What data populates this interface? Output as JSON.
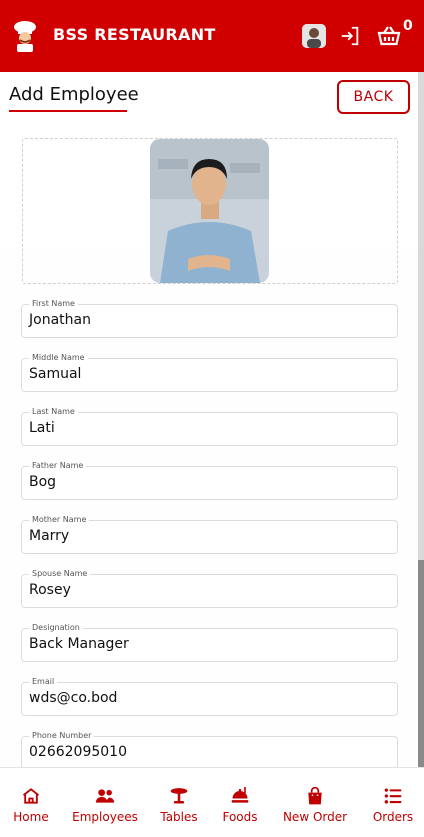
{
  "app": {
    "title": "BSS RESTAURANT",
    "cart_count": "0"
  },
  "header": {
    "icons": [
      "chef-logo-icon",
      "profile-avatar",
      "logout-icon",
      "basket-icon"
    ]
  },
  "page": {
    "title": "Add Employee",
    "back_label": "BACK"
  },
  "form": {
    "photo": "employee-photo",
    "fields": [
      {
        "label": "First Name",
        "value": "Jonathan"
      },
      {
        "label": "Middle Name",
        "value": "Samual"
      },
      {
        "label": "Last Name",
        "value": "Lati"
      },
      {
        "label": "Father Name",
        "value": "Bog"
      },
      {
        "label": "Mother Name",
        "value": "Marry"
      },
      {
        "label": "Spouse Name",
        "value": "Rosey"
      },
      {
        "label": "Designation",
        "value": "Back Manager"
      },
      {
        "label": "Email",
        "value": "wds@co.bod"
      },
      {
        "label": "Phone Number",
        "value": "02662095010"
      }
    ]
  },
  "nav": {
    "items": [
      {
        "label": "Home",
        "icon": "home-icon"
      },
      {
        "label": "Employees",
        "icon": "users-icon"
      },
      {
        "label": "Tables",
        "icon": "table-icon"
      },
      {
        "label": "Foods",
        "icon": "food-icon"
      },
      {
        "label": "New Order",
        "icon": "shopping-bag-icon"
      },
      {
        "label": "Orders",
        "icon": "list-icon"
      }
    ]
  },
  "colors": {
    "brand": "#d10000",
    "accent": "#c00000"
  }
}
